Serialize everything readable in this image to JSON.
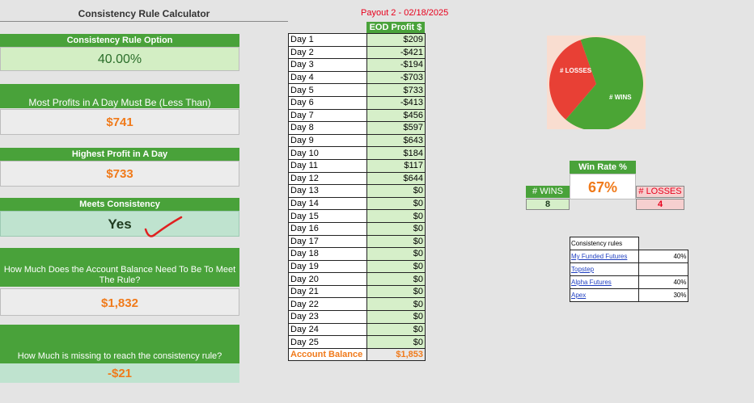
{
  "header": {
    "title": "Consistency Rule Calculator",
    "payout": "Payout 2 - 02/18/2025"
  },
  "left_panel": {
    "option_label": "Consistency Rule Option",
    "option_value": "40.00%",
    "most_profits_label": "Most Profits in A Day Must Be (Less Than)",
    "most_profits_value": "$741",
    "highest_profit_label": "Highest Profit in A Day",
    "highest_profit_value": "$733",
    "meets_label": "Meets Consistency",
    "meets_value": "Yes",
    "balance_needed_label": "How Much Does the Account Balance Need To Be To Meet The Rule?",
    "balance_needed_value": "$1,832",
    "missing_label": "How Much is missing to reach the consistency rule?",
    "missing_value": "-$21"
  },
  "days_table": {
    "header": "EOD Profit $",
    "rows": [
      {
        "day": "Day 1",
        "profit": "$209"
      },
      {
        "day": "Day 2",
        "profit": "-$421"
      },
      {
        "day": "Day 3",
        "profit": "-$194"
      },
      {
        "day": "Day 4",
        "profit": "-$703"
      },
      {
        "day": "Day 5",
        "profit": "$733"
      },
      {
        "day": "Day 6",
        "profit": "-$413"
      },
      {
        "day": "Day 7",
        "profit": "$456"
      },
      {
        "day": "Day 8",
        "profit": "$597"
      },
      {
        "day": "Day 9",
        "profit": "$643"
      },
      {
        "day": "Day 10",
        "profit": "$184"
      },
      {
        "day": "Day 11",
        "profit": "$117"
      },
      {
        "day": "Day 12",
        "profit": "$644"
      },
      {
        "day": "Day 13",
        "profit": "$0"
      },
      {
        "day": "Day 14",
        "profit": "$0"
      },
      {
        "day": "Day 15",
        "profit": "$0"
      },
      {
        "day": "Day 16",
        "profit": "$0"
      },
      {
        "day": "Day 17",
        "profit": "$0"
      },
      {
        "day": "Day 18",
        "profit": "$0"
      },
      {
        "day": "Day 19",
        "profit": "$0"
      },
      {
        "day": "Day 20",
        "profit": "$0"
      },
      {
        "day": "Day 21",
        "profit": "$0"
      },
      {
        "day": "Day 22",
        "profit": "$0"
      },
      {
        "day": "Day 23",
        "profit": "$0"
      },
      {
        "day": "Day 24",
        "profit": "$0"
      },
      {
        "day": "Day 25",
        "profit": "$0"
      }
    ],
    "balance_label": "Account Balance",
    "balance_value": "$1,853"
  },
  "pie": {
    "wins_label": "# WINS",
    "losses_label": "# LOSSES",
    "wins": 8,
    "losses": 4,
    "wins_color": "#4ba535",
    "losses_color": "#e84035"
  },
  "stats": {
    "win_rate_label": "Win Rate %",
    "win_rate_value": "67%",
    "wins_label": "# WINS",
    "wins_value": "8",
    "losses_label": "# LOSSES",
    "losses_value": "4"
  },
  "rules": {
    "header": "Consistency rules",
    "items": [
      {
        "name": "My Funded Futures",
        "value": "40%"
      },
      {
        "name": "Topstep",
        "value": ""
      },
      {
        "name": "Alpha Futures",
        "value": "40%"
      },
      {
        "name": "Apex",
        "value": "30%"
      }
    ]
  },
  "colors": {
    "accent_green": "#49a23a",
    "orange": "#f07a1a",
    "red": "#e8001c"
  }
}
